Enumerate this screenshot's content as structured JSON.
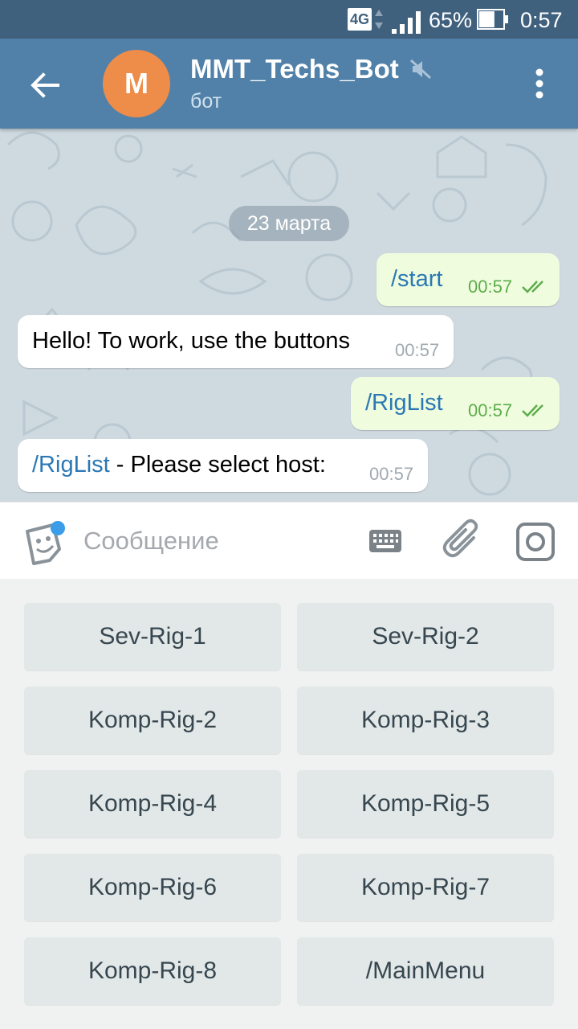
{
  "status_bar": {
    "network": "4G",
    "battery_percent": "65%",
    "battery_level": 0.65,
    "time": "0:57"
  },
  "header": {
    "avatar_letter": "M",
    "title": "MMT_Techs_Bot",
    "subtitle": "бот",
    "muted": true
  },
  "chat": {
    "date": "23 марта",
    "messages": [
      {
        "direction": "out",
        "text": "/start",
        "time": "00:57",
        "read": true
      },
      {
        "direction": "in",
        "text": "Hello! To work, use the buttons",
        "time": "00:57"
      },
      {
        "direction": "out",
        "text": "/RigList",
        "time": "00:57",
        "read": true
      },
      {
        "direction": "in",
        "command": "/RigList",
        "text": " - Please select host:",
        "time": "00:57"
      }
    ]
  },
  "input": {
    "placeholder": "Сообщение",
    "value": ""
  },
  "keyboard": {
    "buttons": [
      "Sev-Rig-1",
      "Sev-Rig-2",
      "Komp-Rig-2",
      "Komp-Rig-3",
      "Komp-Rig-4",
      "Komp-Rig-5",
      "Komp-Rig-6",
      "Komp-Rig-7",
      "Komp-Rig-8",
      "/MainMenu"
    ]
  },
  "colors": {
    "header": "#5181a8",
    "status_bar": "#40617e",
    "avatar": "#ee8c4a",
    "outgoing_bubble": "#effdde",
    "link": "#2b78b5",
    "read_ticks": "#5dac4b",
    "unread_dot": "#3b9de8"
  }
}
